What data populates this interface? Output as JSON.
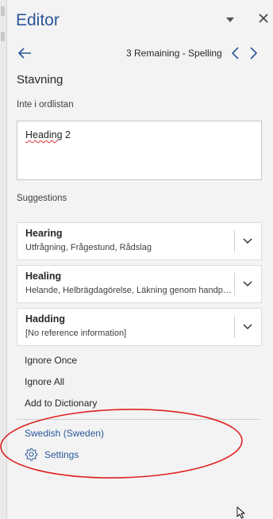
{
  "pane": {
    "title": "Editor",
    "menu_icon": "chevron-down-icon",
    "close_icon": "close-icon"
  },
  "nav": {
    "back_icon": "arrow-left-icon",
    "remaining_text": "3 Remaining - Spelling",
    "prev_icon": "chevron-left-icon",
    "next_icon": "chevron-right-icon"
  },
  "issue": {
    "category": "Stavning",
    "type_label": "Inte i ordlistan",
    "context_word": "Heading",
    "context_rest": " 2"
  },
  "suggestions": {
    "label": "Suggestions",
    "items": [
      {
        "word": "Hearing",
        "desc": "Utfrågning, Frågestund, Rådslag"
      },
      {
        "word": "Healing",
        "desc": "Helande, Helbrägdagörelse, Läkning genom handpåläggning"
      },
      {
        "word": "Hadding",
        "desc": "[No reference information]"
      }
    ]
  },
  "actions": {
    "ignore_once": {
      "first": "I",
      "rest": "gnore Once"
    },
    "ignore_all": {
      "first": "I",
      "rest": "gnore All"
    },
    "add_to_dictionary": {
      "first": "A",
      "rest": "dd to Dictionary"
    }
  },
  "footer": {
    "language": "Swedish (Sweden)",
    "settings": "Settings",
    "settings_icon": "gear-icon"
  },
  "colors": {
    "accent": "#2b579a",
    "misspelling_underline": "#e0312f",
    "annotation_ellipse": "#e02020",
    "pane_background": "#f3f3f3"
  }
}
